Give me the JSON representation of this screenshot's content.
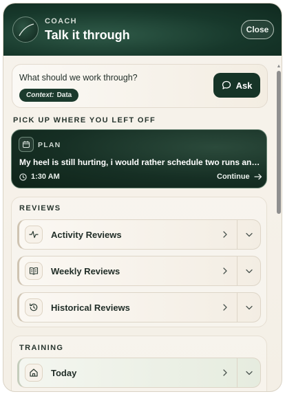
{
  "header": {
    "kicker": "COACH",
    "title": "Talk it through",
    "close_label": "Close"
  },
  "ask": {
    "question": "What should we work through?",
    "context_key": "Context:",
    "context_value": "Data",
    "button_label": "Ask"
  },
  "resume": {
    "section_title": "PICK UP WHERE YOU LEFT OFF",
    "tag": "PLAN",
    "text": "My heel is still hurting, i would rather schedule two runs and k...",
    "time": "1:30 AM",
    "continue_label": "Continue"
  },
  "reviews": {
    "section_title": "REVIEWS",
    "items": [
      {
        "label": "Activity Reviews",
        "icon": "activity-icon"
      },
      {
        "label": "Weekly Reviews",
        "icon": "book-icon"
      },
      {
        "label": "Historical Reviews",
        "icon": "history-icon"
      }
    ]
  },
  "training": {
    "section_title": "TRAINING",
    "items": [
      {
        "label": "Today",
        "icon": "home-icon"
      }
    ]
  },
  "colors": {
    "brand_dark_green": "#163427",
    "header_green": "#17382b",
    "panel_cream": "#f6f1e8"
  }
}
